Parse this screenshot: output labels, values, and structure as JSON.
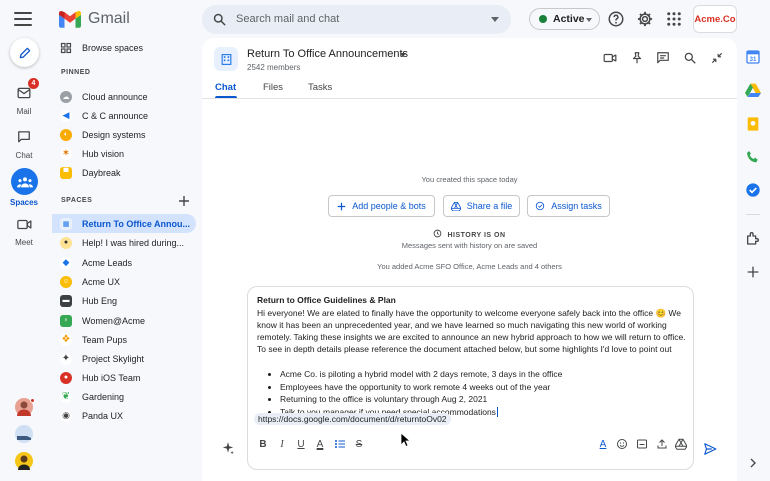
{
  "app": {
    "name": "Gmail"
  },
  "search": {
    "placeholder": "Search mail and chat"
  },
  "status": {
    "label": "Active",
    "color": "#188038"
  },
  "account": {
    "label": "Acme.Co"
  },
  "rail": {
    "items": [
      {
        "label": "Mail",
        "icon": "mail-icon",
        "badge": "4"
      },
      {
        "label": "Chat",
        "icon": "chat-icon"
      },
      {
        "label": "Spaces",
        "icon": "spaces-icon",
        "active": true
      },
      {
        "label": "Meet",
        "icon": "meet-icon"
      }
    ]
  },
  "nav": {
    "browse": "Browse spaces",
    "pinned_header": "PINNED",
    "pinned": [
      {
        "label": "Cloud announce",
        "icon": "cloud-icon"
      },
      {
        "label": "C & C announce",
        "icon": "megaphone-icon"
      },
      {
        "label": "Design systems",
        "icon": "design-icon"
      },
      {
        "label": "Hub vision",
        "icon": "hub-icon"
      },
      {
        "label": "Daybreak",
        "icon": "daybreak-icon"
      }
    ],
    "spaces_header": "SPACES",
    "spaces": [
      {
        "label": "Return To Office Annou...",
        "icon": "office-icon",
        "active": true
      },
      {
        "label": "Help! I was hired during...",
        "icon": "help-icon"
      },
      {
        "label": "Acme Leads",
        "icon": "leads-icon"
      },
      {
        "label": "Acme UX",
        "icon": "ux-icon"
      },
      {
        "label": "Hub Eng",
        "icon": "eng-icon"
      },
      {
        "label": "Women@Acme",
        "icon": "women-icon"
      },
      {
        "label": "Team Pups",
        "icon": "pups-icon"
      },
      {
        "label": "Project Skylight",
        "icon": "skylight-icon"
      },
      {
        "label": "Hub iOS Team",
        "icon": "ios-icon"
      },
      {
        "label": "Gardening",
        "icon": "gardening-icon"
      },
      {
        "label": "Panda UX",
        "icon": "panda-icon"
      }
    ]
  },
  "space": {
    "title": "Return To Office Announcements",
    "members": "2542 members",
    "tabs": [
      {
        "label": "Chat",
        "active": true
      },
      {
        "label": "Files"
      },
      {
        "label": "Tasks"
      }
    ]
  },
  "conversation": {
    "created": "You created this space today",
    "actions": [
      {
        "label": "Add people & bots",
        "icon": "add-person-icon"
      },
      {
        "label": "Share a file",
        "icon": "drive-icon"
      },
      {
        "label": "Assign tasks",
        "icon": "task-icon"
      }
    ],
    "history_label": "HISTORY IS ON",
    "history_sub": "Messages sent with history on are saved",
    "added": "You added Acme SFO Office, Acme Leads and 4 others"
  },
  "composer": {
    "title": "Return to Office Guidelines & Plan",
    "body": "Hi everyone! We are elated to finally have the opportunity to welcome everyone safely back into the office 😊 We know it has been an unprecedented year, and we have learned so much navigating this new world of working remotely. Taking these insights we are excited to announce an new hybrid approach to how we will return to office. To see in depth details please reference the document attached below, but some highlights I'd love to point out",
    "bullets": [
      "Acme Co. is piloting a hybrid model with 2 days remote, 3 days in the office",
      "Employees have the opportunity to work remote 4 weeks out of the year",
      "Returning to the office is voluntary through Aug 2, 2021",
      "Talk to you manager if you need special accommodations"
    ],
    "link": "https://docs.google.com/document/d/returntoOv02"
  },
  "colors": {
    "accent": "#0b57d0",
    "active_nav_bg": "#d3e3fd",
    "badge": "#d93025"
  }
}
